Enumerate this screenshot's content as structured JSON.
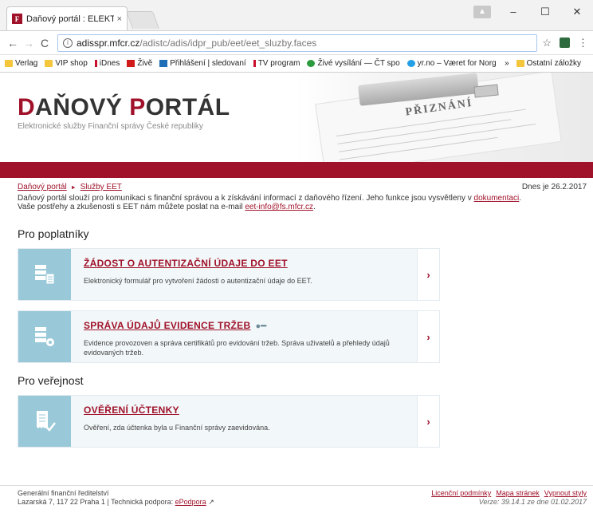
{
  "browser": {
    "tab_title": "Daňový portál : ELEKTRO",
    "tab_close": "×",
    "favicon_letter": "F",
    "url_host": "adisspr.mfcr.cz",
    "url_path": "/adistc/adis/idpr_pub/eet/eet_sluzby.faces",
    "info_symbol": "i",
    "star": "☆",
    "menu": "⋮",
    "win_min": "–",
    "win_max": "☐",
    "win_close": "✕",
    "bookmarks": [
      {
        "label": "Verlag",
        "icon": "folder"
      },
      {
        "label": "VIP shop",
        "icon": "folder"
      },
      {
        "label": "iDnes",
        "icon": "idnes"
      },
      {
        "label": "Živě",
        "icon": "zive"
      },
      {
        "label": "Přihlášení | sledovaní",
        "icon": "po"
      },
      {
        "label": "TV program",
        "icon": "idnes"
      },
      {
        "label": "Živé vysílání — ČT spo",
        "icon": "ct"
      },
      {
        "label": "yr.no – Været for Norg",
        "icon": "yr"
      }
    ],
    "bookmarks_more": "»",
    "other_bookmarks": "Ostatní záložky"
  },
  "header": {
    "logo_d": "D",
    "logo_rest1": "AŇOVÝ ",
    "logo_p": "P",
    "logo_rest2": "ORTÁL",
    "subtitle": "Elektronické služby Finanční správy České republiky",
    "art_text": "PŘIZNÁNÍ"
  },
  "breadcrumb": {
    "home": "Daňový portál",
    "separator": "►",
    "current": "Služby EET"
  },
  "date": "Dnes je 26.2.2017",
  "intro": {
    "line1_start": "Daňový portál slouží pro komunikaci s finanční správou a k získávání informací z daňového řízení. Jeho funkce jsou vysvětleny v ",
    "line1_link": "dokumentaci",
    "line1_end": ".",
    "line2_start": "Vaše postřehy a zkušenosti s EET nám můžete poslat na e-mail ",
    "line2_link": "eet-info@fs.mfcr.cz",
    "line2_end": "."
  },
  "sections": {
    "payers": "Pro poplatníky",
    "public": "Pro veřejnost"
  },
  "cards": [
    {
      "title": "ŽÁDOST O AUTENTIZAČNÍ ÚDAJE DO EET",
      "desc": "Elektronický formulář pro vytvoření žádosti o autentizační údaje do EET.",
      "arrow": "›"
    },
    {
      "title": "SPRÁVA ÚDAJŮ EVIDENCE TRŽEB",
      "desc": "Evidence provozoven a správa certifikátů pro evidování tržeb. Správa uživatelů a přehledy údajů evidovaných tržeb.",
      "arrow": "›"
    },
    {
      "title": "OVĚŘENÍ ÚČTENKY",
      "desc": "Ověření, zda účtenka byla u Finanční správy zaevidována.",
      "arrow": "›"
    }
  ],
  "footer": {
    "org": "Generální finanční ředitelství",
    "address": "Lazarská 7, 117 22 Praha 1 | Technická podpora: ",
    "support_link": "ePodpora",
    "links": [
      "Licenční podmínky",
      "Mapa stránek",
      "Vypnout styly"
    ],
    "version": "Verze: 39.14.1 ze dne 01.02.2017"
  },
  "colors": {
    "brand": "#a0122a",
    "tile": "#99c9d9",
    "card_bg": "#f2f7f9"
  }
}
